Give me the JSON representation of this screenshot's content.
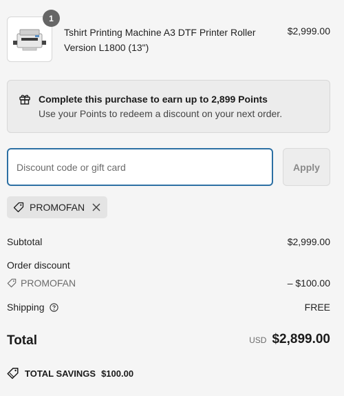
{
  "product": {
    "quantity": "1",
    "name": "Tshirt Printing Machine A3 DTF Printer Roller Version L1800 (13\")",
    "price": "$2,999.00",
    "image_icon": "printer-image"
  },
  "points_banner": {
    "icon": "gift-icon",
    "title": "Complete this purchase to earn up to 2,899 Points",
    "subtitle": "Use your Points to redeem a discount on your next order."
  },
  "discount": {
    "placeholder": "Discount code or gift card",
    "value": "",
    "apply_label": "Apply"
  },
  "applied_code": {
    "label": "PROMOFAN",
    "icon": "tag-icon",
    "remove_icon": "close-icon"
  },
  "summary": {
    "subtotal_label": "Subtotal",
    "subtotal_value": "$2,999.00",
    "order_discount_label": "Order discount",
    "promo_code": "PROMOFAN",
    "promo_value": "– $100.00",
    "shipping_label": "Shipping",
    "shipping_value": "FREE",
    "total_label": "Total",
    "currency": "USD",
    "total_value": "$2,899.00"
  },
  "savings": {
    "label": "TOTAL SAVINGS",
    "value": "$100.00"
  },
  "colors": {
    "accent_focus": "#2c6fa3",
    "background": "#f5f5f5",
    "badge": "#666666"
  }
}
